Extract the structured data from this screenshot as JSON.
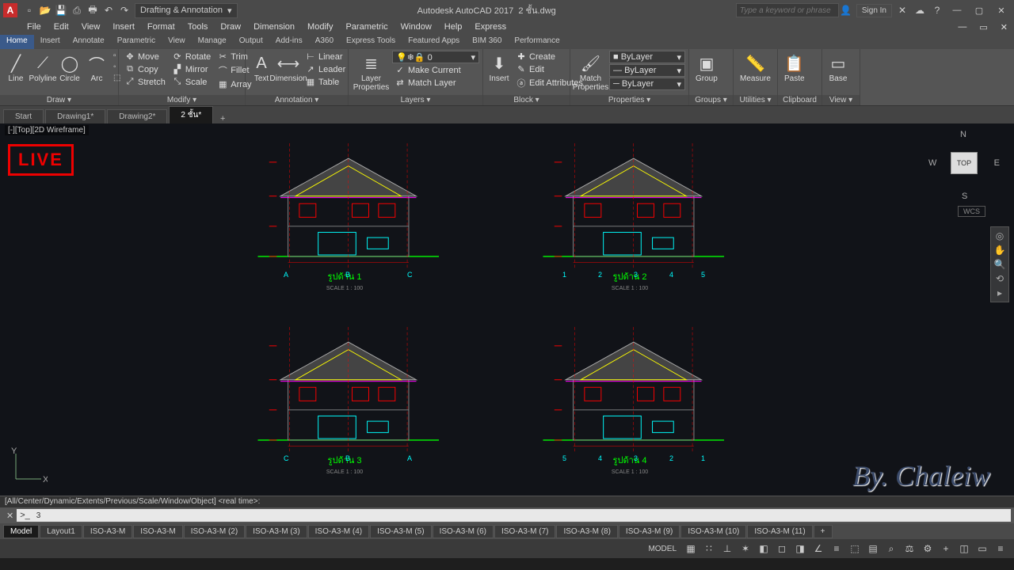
{
  "title": {
    "app": "Autodesk AutoCAD 2017",
    "file": "2 ชั้น.dwg",
    "workspace": "Drafting & Annotation",
    "search_ph": "Type a keyword or phrase",
    "signin": "Sign In"
  },
  "menus": [
    "File",
    "Edit",
    "View",
    "Insert",
    "Format",
    "Tools",
    "Draw",
    "Dimension",
    "Modify",
    "Parametric",
    "Window",
    "Help",
    "Express"
  ],
  "ribbon_tabs": [
    "Home",
    "Insert",
    "Annotate",
    "Parametric",
    "View",
    "Manage",
    "Output",
    "Add-ins",
    "A360",
    "Express Tools",
    "Featured Apps",
    "BIM 360",
    "Performance"
  ],
  "draw": {
    "line": "Line",
    "polyline": "Polyline",
    "circle": "Circle",
    "arc": "Arc",
    "title": "Draw ▾"
  },
  "modify": {
    "move": "Move",
    "rotate": "Rotate",
    "trim": "Trim",
    "copy": "Copy",
    "mirror": "Mirror",
    "fillet": "Fillet",
    "stretch": "Stretch",
    "scale": "Scale",
    "array": "Array",
    "title": "Modify ▾"
  },
  "annot": {
    "text": "Text",
    "dim": "Dimension",
    "linear": "Linear",
    "leader": "Leader",
    "table": "Table",
    "title": "Annotation ▾"
  },
  "layers": {
    "btn": "Layer\nProperties",
    "make": "Make Current",
    "match": "Match Layer",
    "title": "Layers ▾",
    "current": "0"
  },
  "block": {
    "insert": "Insert",
    "create": "Create",
    "edit": "Edit",
    "attr": "Edit Attributes",
    "title": "Block ▾"
  },
  "props": {
    "match": "Match\nProperties",
    "layer": "ByLayer",
    "title": "Properties ▾"
  },
  "groups": {
    "btn": "Group",
    "title": "Groups ▾"
  },
  "util": {
    "btn": "Measure",
    "title": "Utilities ▾"
  },
  "clip": {
    "btn": "Paste",
    "title": "Clipboard"
  },
  "view": {
    "btn": "Base",
    "title": "View ▾"
  },
  "file_tabs": [
    "Start",
    "Drawing1*",
    "Drawing2*",
    "2 ชั้น*"
  ],
  "viewport": "[-][Top][2D Wireframe]",
  "live": "LIVE",
  "viewcube": {
    "n": "N",
    "s": "S",
    "e": "E",
    "w": "W",
    "top": "TOP",
    "wcs": "WCS"
  },
  "signature": "By.   Chaleiw",
  "ucs": {
    "y": "Y",
    "x": "X"
  },
  "cmd": {
    "hist": "[All/Center/Dynamic/Extents/Previous/Scale/Window/Object] <real time>:",
    "prompt": ">_",
    "value": "3"
  },
  "layout_tabs": [
    "Model",
    "Layout1",
    "ISO-A3-M",
    "ISO-A3-M",
    "ISO-A3-M (2)",
    "ISO-A3-M (3)",
    "ISO-A3-M (4)",
    "ISO-A3-M (5)",
    "ISO-A3-M (6)",
    "ISO-A3-M (7)",
    "ISO-A3-M (8)",
    "ISO-A3-M (9)",
    "ISO-A3-M (10)",
    "ISO-A3-M (11)",
    "+"
  ],
  "status": {
    "model": "MODEL"
  },
  "elev": {
    "t1": "รูปด้าน  1",
    "t2": "รูปด้าน  2",
    "t3": "รูปด้าน  3",
    "t4": "รูปด้าน  4",
    "scale": "SCALE  1 : 100"
  },
  "axis": {
    "a": "A",
    "b": "B",
    "c": "C",
    "n1": "1",
    "n2": "2",
    "n3": "3",
    "n4": "4",
    "n5": "5"
  }
}
